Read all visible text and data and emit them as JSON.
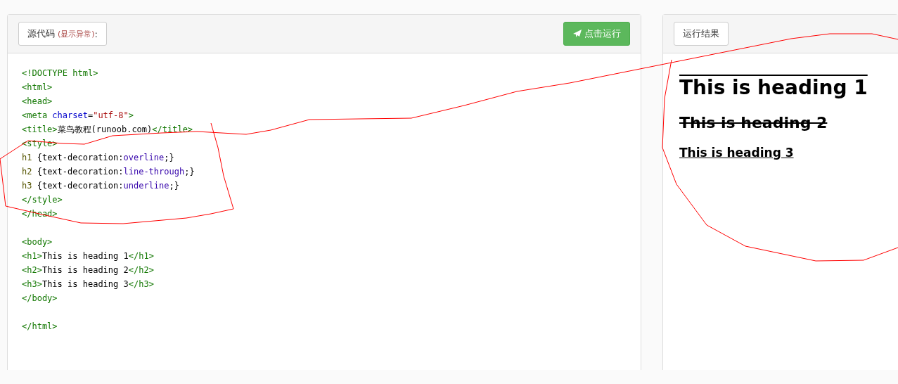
{
  "source_panel": {
    "label": "源代码",
    "note": "(显示异常)",
    "colon": ":",
    "run_button": "点击运行",
    "code": {
      "blocks": [
        {
          "lines": [
            {
              "tokens": [
                {
                  "kind": "tag",
                  "text": "<!DOCTYPE html>"
                }
              ]
            },
            {
              "tokens": [
                {
                  "kind": "tag",
                  "text": "<html>"
                }
              ]
            },
            {
              "tokens": [
                {
                  "kind": "tag",
                  "text": "<head>"
                }
              ]
            },
            {
              "tokens": [
                {
                  "kind": "tag",
                  "text": "<meta "
                },
                {
                  "kind": "attr",
                  "text": "charset"
                },
                {
                  "kind": "text",
                  "text": "="
                },
                {
                  "kind": "string",
                  "text": "\"utf-8\""
                },
                {
                  "kind": "tag",
                  "text": ">"
                }
              ]
            },
            {
              "tokens": [
                {
                  "kind": "tag",
                  "text": "<title>"
                },
                {
                  "kind": "text",
                  "text": "菜鸟教程(runoob.com)"
                },
                {
                  "kind": "tag",
                  "text": "</title>"
                }
              ]
            },
            {
              "tokens": [
                {
                  "kind": "tag",
                  "text": "<style>"
                }
              ]
            },
            {
              "tokens": [
                {
                  "kind": "selector",
                  "text": "h1"
                },
                {
                  "kind": "text",
                  "text": " {text-decoration:"
                },
                {
                  "kind": "keyword",
                  "text": "overline"
                },
                {
                  "kind": "text",
                  "text": ";}"
                }
              ]
            },
            {
              "tokens": [
                {
                  "kind": "selector",
                  "text": "h2"
                },
                {
                  "kind": "text",
                  "text": " {text-decoration:"
                },
                {
                  "kind": "keyword",
                  "text": "line-through"
                },
                {
                  "kind": "text",
                  "text": ";}"
                }
              ]
            },
            {
              "tokens": [
                {
                  "kind": "selector",
                  "text": "h3"
                },
                {
                  "kind": "text",
                  "text": " {text-decoration:"
                },
                {
                  "kind": "keyword",
                  "text": "underline"
                },
                {
                  "kind": "text",
                  "text": ";}"
                }
              ]
            },
            {
              "tokens": [
                {
                  "kind": "tag",
                  "text": "</style>"
                }
              ]
            },
            {
              "tokens": [
                {
                  "kind": "tag",
                  "text": "</head>"
                }
              ]
            }
          ]
        },
        {
          "lines": [
            {
              "tokens": [
                {
                  "kind": "tag",
                  "text": "<body>"
                }
              ]
            },
            {
              "tokens": [
                {
                  "kind": "tag",
                  "text": "<h1>"
                },
                {
                  "kind": "text",
                  "text": "This is heading 1"
                },
                {
                  "kind": "tag",
                  "text": "</h1>"
                }
              ]
            },
            {
              "tokens": [
                {
                  "kind": "tag",
                  "text": "<h2>"
                },
                {
                  "kind": "text",
                  "text": "This is heading 2"
                },
                {
                  "kind": "tag",
                  "text": "</h2>"
                }
              ]
            },
            {
              "tokens": [
                {
                  "kind": "tag",
                  "text": "<h3>"
                },
                {
                  "kind": "text",
                  "text": "This is heading 3"
                },
                {
                  "kind": "tag",
                  "text": "</h3>"
                }
              ]
            },
            {
              "tokens": [
                {
                  "kind": "tag",
                  "text": "</body>"
                }
              ]
            }
          ]
        },
        {
          "lines": [
            {
              "tokens": [
                {
                  "kind": "tag",
                  "text": "</html>"
                }
              ]
            }
          ]
        }
      ]
    }
  },
  "result_panel": {
    "label": "运行结果",
    "headings": [
      {
        "kind": "overline",
        "text": "This is heading 1"
      },
      {
        "kind": "line-through",
        "text": "This is heading 2"
      },
      {
        "kind": "underline",
        "text": "This is heading 3"
      }
    ]
  }
}
